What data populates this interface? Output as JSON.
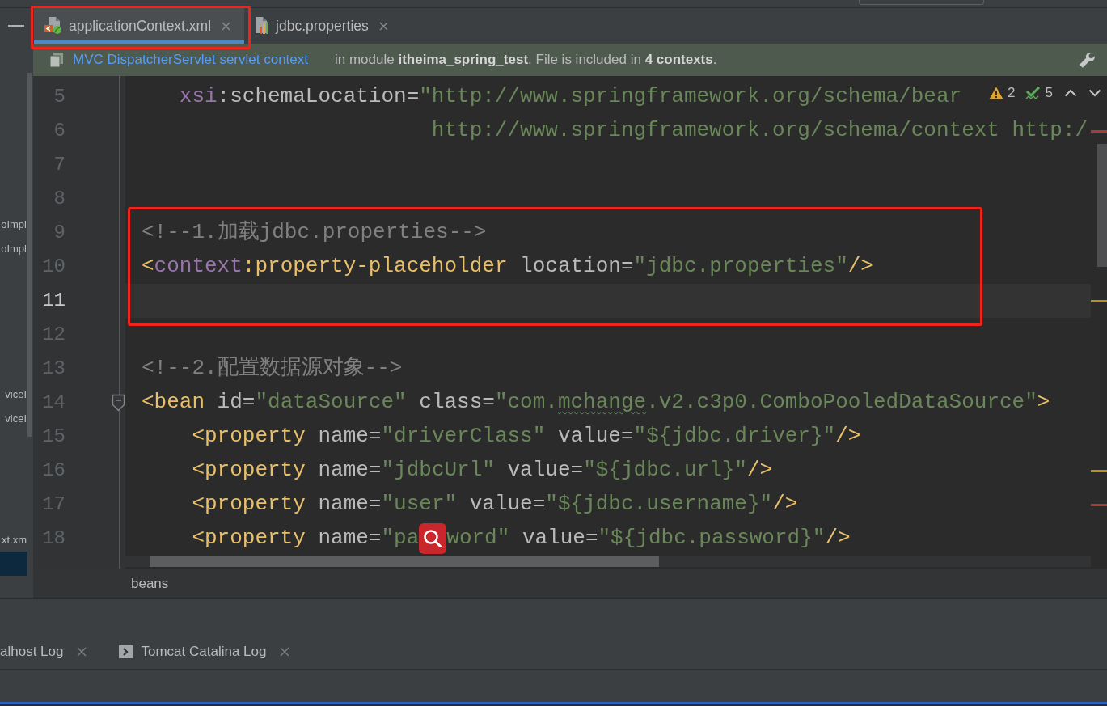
{
  "sidebar": {
    "items": [
      {
        "label": "oImpl",
        "selected": false
      },
      {
        "label": "oImpl",
        "selected": false
      },
      {
        "label": "viceI",
        "selected": false
      },
      {
        "label": "viceI",
        "selected": false
      },
      {
        "label": "xt.xm",
        "selected": false
      },
      {
        "selected": true
      }
    ]
  },
  "tabs": [
    {
      "label": "applicationContext.xml",
      "kind": "xml",
      "selected": true,
      "outlined": true
    },
    {
      "label": "jdbc.properties",
      "kind": "properties",
      "selected": false,
      "outlined": false
    }
  ],
  "banner": {
    "link": "MVC DispatcherServlet servlet context",
    "message": "in module **itheima_spring_test**. File is included in **4 contexts**."
  },
  "editor": {
    "inspections": {
      "warnings": "2",
      "weak_warnings": "5"
    },
    "blocks": [
      {
        "outlined": false,
        "lines": [
          {
            "number": "5",
            "kind": "attribute",
            "current": false,
            "fold": false,
            "tokens": [
              {
                "kind": "ns",
                "text": "xsi"
              },
              {
                "kind": "attr",
                "text": ":schemaLocation="
              },
              {
                "kind": "str",
                "text": "\"http://www.springframework.org/schema/bear"
              }
            ]
          },
          {
            "number": "6",
            "kind": "continuation",
            "current": false,
            "fold": false,
            "marker": {
              "color": "#a93a36"
            },
            "tokens": [
              {
                "kind": "str",
                "text": "http://www.springframework.org/schema/context http:/"
              }
            ]
          },
          {
            "number": "7",
            "kind": "code",
            "current": false,
            "fold": false
          },
          {
            "number": "8",
            "kind": "code",
            "current": false,
            "fold": false
          }
        ]
      },
      {
        "outlined": true,
        "lines": [
          {
            "number": "9",
            "kind": "code",
            "current": false,
            "fold": false,
            "tokens": [
              {
                "kind": "comment",
                "text": "<!--1.加载jdbc.properties-->"
              }
            ]
          },
          {
            "number": "10",
            "kind": "code",
            "current": false,
            "fold": false,
            "tokens": [
              {
                "kind": "tag",
                "text": "<"
              },
              {
                "kind": "ns",
                "text": "context"
              },
              {
                "kind": "tag",
                "text": ":property-placeholder"
              },
              {
                "kind": "attr",
                "text": " location="
              },
              {
                "kind": "str",
                "text": "\"jdbc.properties\""
              },
              {
                "kind": "tag",
                "text": "/>"
              }
            ]
          },
          {
            "number": "11",
            "kind": "code",
            "current": true,
            "fold": false,
            "marker": {
              "color": "#b8921f"
            }
          }
        ]
      },
      {
        "outlined": false,
        "lines": [
          {
            "number": "12",
            "kind": "code",
            "current": false,
            "fold": false
          },
          {
            "number": "13",
            "kind": "code",
            "current": false,
            "fold": false,
            "tokens": [
              {
                "kind": "comment",
                "text": "<!--2.配置数据源对象-->"
              }
            ]
          },
          {
            "number": "14",
            "kind": "code",
            "current": false,
            "fold": true,
            "tokens": [
              {
                "kind": "tag",
                "text": "<bean"
              },
              {
                "kind": "attr",
                "text": " id="
              },
              {
                "kind": "str",
                "text": "\"dataSource\""
              },
              {
                "kind": "attr",
                "text": " class="
              },
              {
                "kind": "str",
                "text": "\"com."
              },
              {
                "kind": "typo",
                "text": "mchange"
              },
              {
                "kind": "str",
                "text": ".v2.c3p0.ComboPooledDataSource\""
              },
              {
                "kind": "tag",
                "text": ">"
              }
            ],
            "children": [
              {
                "number": "15",
                "current": false,
                "fold": false,
                "tokens": [
                  {
                    "kind": "tag",
                    "text": "<property"
                  },
                  {
                    "kind": "attr",
                    "text": " name="
                  },
                  {
                    "kind": "str",
                    "text": "\"driverClass\""
                  },
                  {
                    "kind": "attr",
                    "text": " value="
                  },
                  {
                    "kind": "str",
                    "text": "\"${jdbc.driver}\""
                  },
                  {
                    "kind": "tag",
                    "text": "/>"
                  }
                ]
              },
              {
                "number": "16",
                "current": false,
                "fold": false,
                "marker": {
                  "color": "#b8921f"
                },
                "tokens": [
                  {
                    "kind": "tag",
                    "text": "<property"
                  },
                  {
                    "kind": "attr",
                    "text": " name="
                  },
                  {
                    "kind": "str",
                    "text": "\"jdbcUrl\""
                  },
                  {
                    "kind": "attr",
                    "text": " value="
                  },
                  {
                    "kind": "str",
                    "text": "\"${jdbc.url}\""
                  },
                  {
                    "kind": "tag",
                    "text": "/>"
                  }
                ]
              },
              {
                "number": "17",
                "current": false,
                "fold": false,
                "marker": {
                  "color": "#a93a36"
                },
                "tokens": [
                  {
                    "kind": "tag",
                    "text": "<property"
                  },
                  {
                    "kind": "attr",
                    "text": " name="
                  },
                  {
                    "kind": "str",
                    "text": "\"user\""
                  },
                  {
                    "kind": "attr",
                    "text": " value="
                  },
                  {
                    "kind": "str",
                    "text": "\"${jdbc.username}\""
                  },
                  {
                    "kind": "tag",
                    "text": "/>"
                  }
                ]
              },
              {
                "number": "18",
                "current": false,
                "fold": false,
                "tokens": [
                  {
                    "kind": "tag",
                    "text": "<property"
                  },
                  {
                    "kind": "attr",
                    "text": " name="
                  },
                  {
                    "kind": "str",
                    "text": "\"pa"
                  },
                  {
                    "kind": "badge"
                  },
                  {
                    "kind": "str",
                    "text": "word\""
                  },
                  {
                    "kind": "attr",
                    "text": " value="
                  },
                  {
                    "kind": "str",
                    "text": "\"${jdbc.password}\""
                  },
                  {
                    "kind": "tag",
                    "text": "/>"
                  }
                ]
              }
            ]
          }
        ]
      }
    ]
  },
  "breadcrumbs": [
    "beans"
  ],
  "bottom_panel": {
    "tabs": [
      {
        "label": "alhost Log",
        "kind": "log",
        "selected": false
      },
      {
        "label": "Tomcat Catalina Log",
        "kind": "console",
        "selected": false
      }
    ]
  }
}
